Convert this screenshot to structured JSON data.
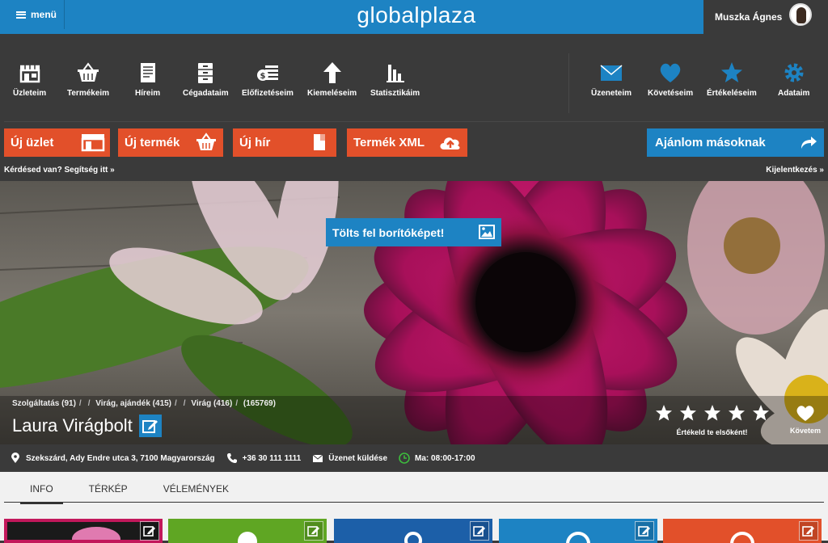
{
  "header": {
    "menu_label": "menü",
    "logo": "globalplaza",
    "user_name": "Muszka Ágnes"
  },
  "toolbar": {
    "left": [
      {
        "label": "Üzleteim",
        "icon": "store-icon"
      },
      {
        "label": "Termékeim",
        "icon": "basket-icon"
      },
      {
        "label": "Híreim",
        "icon": "news-icon"
      },
      {
        "label": "Cégadataim",
        "icon": "cabinet-icon"
      },
      {
        "label": "Előfizetéseim",
        "icon": "coins-icon"
      },
      {
        "label": "Kiemeléseim",
        "icon": "arrow-up-icon"
      },
      {
        "label": "Statisztikáim",
        "icon": "bar-chart-icon"
      }
    ],
    "right": [
      {
        "label": "Üzeneteim",
        "icon": "envelope-icon"
      },
      {
        "label": "Követéseim",
        "icon": "heart-icon"
      },
      {
        "label": "Értékeléseim",
        "icon": "star-icon"
      },
      {
        "label": "Adataim",
        "icon": "gear-icon"
      }
    ]
  },
  "actions": {
    "new_shop": "Új üzlet",
    "new_product": "Új termék",
    "new_news": "Új hír",
    "product_xml": "Termék XML",
    "recommend": "Ajánlom másoknak"
  },
  "help": {
    "question": "Kérdésed van? Segítség itt »",
    "logout": "Kijelentkezés »"
  },
  "cover": {
    "upload_label": "Tölts fel borítóképet!"
  },
  "shop": {
    "breadcrumbs": [
      "Szolgáltatás (91)",
      "Virág, ajándék (415)",
      "Virág (416)",
      "(165769)"
    ],
    "name": "Laura Virágbolt",
    "rating_label": "Értékeld te elsőként!",
    "rating_stars": 5,
    "follow_label": "Követem",
    "address": "Szekszárd, Ady Endre utca 3, 7100 Magyarország",
    "phone": "+36 30 111 1111",
    "message": "Üzenet küldése",
    "hours": "Ma: 08:00-17:00"
  },
  "tabs": [
    "INFO",
    "TÉRKÉP",
    "VÉLEMÉNYEK"
  ],
  "colors": {
    "brand_blue": "#1d83c3",
    "action_orange": "#e2502a",
    "dark_bg": "#3a3a3a",
    "card_colors": [
      "#c2185b",
      "#5fa623",
      "#1c5fa8",
      "#1d83c3",
      "#e2502a"
    ]
  }
}
